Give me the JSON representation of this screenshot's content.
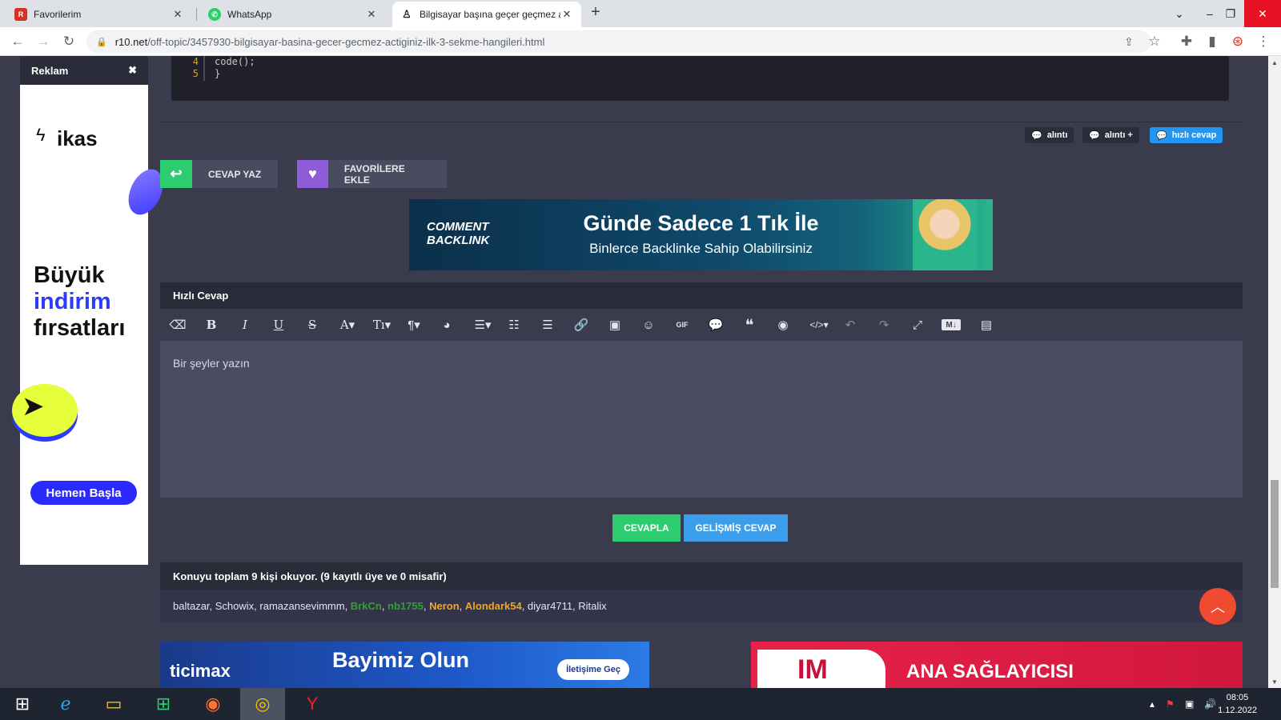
{
  "browser": {
    "tabs": [
      {
        "title": "Favorilerim",
        "favicon": "r10-icon"
      },
      {
        "title": "WhatsApp",
        "favicon": "whatsapp-icon"
      },
      {
        "title": "Bilgisayar başına geçer geçmez a",
        "favicon": "r10-icon"
      }
    ],
    "url_host": "r10.net",
    "url_path": "/off-topic/3457930-bilgisayar-basina-gecer-gecmez-actiginiz-ilk-3-sekme-hangileri.html"
  },
  "sidebar_ad": {
    "header": "Reklam",
    "brand": "ikas",
    "headline_1": "Büyük",
    "headline_2": "indirim",
    "headline_3": "fırsatları",
    "cta": "Hemen Başla"
  },
  "code": {
    "lines": [
      {
        "num": "4",
        "text": "code();"
      },
      {
        "num": "5",
        "text": "}"
      }
    ]
  },
  "post_actions": {
    "quote": "alıntı",
    "quote_plus": "alıntı +",
    "quick_reply": "hızlı cevap"
  },
  "buttons": {
    "reply": "CEVAP YAZ",
    "favorite": "FAVORİLERE EKLE",
    "submit": "CEVAPLA",
    "advanced": "GELİŞMİŞ CEVAP"
  },
  "banner": {
    "logo_line1": "COMMENT",
    "logo_line2": "BACKLINK",
    "headline": "Günde Sadece 1 Tık İle",
    "subline": "Binlerce Backlinke Sahip Olabilirsiniz"
  },
  "editor": {
    "title": "Hızlı Cevap",
    "placeholder": "Bir şeyler yazın",
    "tool_gif": "GIF",
    "tool_md": "M↓"
  },
  "readers": {
    "title": "Konuyu toplam 9 kişi okuyor. (9 kayıtlı üye ve 0 misafir)",
    "plain_1": "baltazar, Schowix, ramazansevimmm, ",
    "green_1": "BrkCn",
    "green_2": "nb1755",
    "gold_1": "Neron",
    "gold_2": "Alondark54",
    "plain_2": ", diyar4711, Ritalix"
  },
  "bottom_ads": {
    "left_brand": "ticimax",
    "left_headline": "Bayimiz Olun",
    "left_button": "İletişime Geç",
    "right_logo": "IM",
    "right_headline": "ANA SAĞLAYICISI"
  },
  "taskbar": {
    "time": "08:05",
    "date": "1.12.2022"
  },
  "colors": {
    "page_bg": "#3a3b4d",
    "green": "#2ecc71",
    "purple": "#8e5bd9",
    "blue": "#2196f3",
    "orange": "#f04a30"
  }
}
